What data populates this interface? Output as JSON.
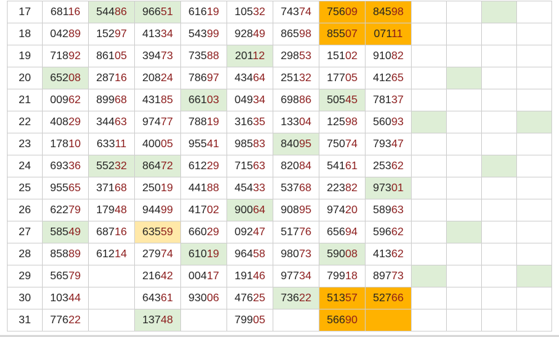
{
  "colors": {
    "green_cell": "#deeed6",
    "orange_cell": "#ffb200",
    "yellow_cell": "#ffe8a8",
    "row_number_text": "#2144c8",
    "last_two_digits_text": "#8b1a1a"
  },
  "rows": [
    {
      "day": "17",
      "cells": [
        {
          "v": "68116",
          "bg": ""
        },
        {
          "v": "54486",
          "bg": "g"
        },
        {
          "v": "96651",
          "bg": "g"
        },
        {
          "v": "61619",
          "bg": ""
        },
        {
          "v": "10532",
          "bg": ""
        },
        {
          "v": "74374",
          "bg": ""
        },
        {
          "v": "75609",
          "bg": "o"
        },
        {
          "v": "84598",
          "bg": "o"
        }
      ],
      "pads": [
        "",
        "",
        "g",
        ""
      ]
    },
    {
      "day": "18",
      "cells": [
        {
          "v": "04289",
          "bg": ""
        },
        {
          "v": "15297",
          "bg": ""
        },
        {
          "v": "41334",
          "bg": ""
        },
        {
          "v": "54399",
          "bg": ""
        },
        {
          "v": "92849",
          "bg": ""
        },
        {
          "v": "86598",
          "bg": ""
        },
        {
          "v": "85507",
          "bg": "o"
        },
        {
          "v": "07111",
          "bg": "o"
        }
      ],
      "pads": [
        "",
        "",
        "",
        ""
      ]
    },
    {
      "day": "19",
      "cells": [
        {
          "v": "71892",
          "bg": ""
        },
        {
          "v": "86105",
          "bg": ""
        },
        {
          "v": "39473",
          "bg": ""
        },
        {
          "v": "73588",
          "bg": ""
        },
        {
          "v": "20112",
          "bg": "g"
        },
        {
          "v": "29853",
          "bg": ""
        },
        {
          "v": "15102",
          "bg": ""
        },
        {
          "v": "91082",
          "bg": ""
        }
      ],
      "pads": [
        "",
        "",
        "",
        ""
      ]
    },
    {
      "day": "20",
      "cells": [
        {
          "v": "65208",
          "bg": "g"
        },
        {
          "v": "28716",
          "bg": ""
        },
        {
          "v": "20824",
          "bg": ""
        },
        {
          "v": "78697",
          "bg": ""
        },
        {
          "v": "43464",
          "bg": ""
        },
        {
          "v": "25132",
          "bg": ""
        },
        {
          "v": "17705",
          "bg": ""
        },
        {
          "v": "41265",
          "bg": ""
        }
      ],
      "pads": [
        "",
        "g",
        "",
        ""
      ]
    },
    {
      "day": "21",
      "cells": [
        {
          "v": "00962",
          "bg": ""
        },
        {
          "v": "89968",
          "bg": ""
        },
        {
          "v": "43185",
          "bg": ""
        },
        {
          "v": "66103",
          "bg": "g"
        },
        {
          "v": "04934",
          "bg": ""
        },
        {
          "v": "69886",
          "bg": ""
        },
        {
          "v": "50545",
          "bg": "g"
        },
        {
          "v": "78137",
          "bg": ""
        }
      ],
      "pads": [
        "",
        "",
        "",
        ""
      ]
    },
    {
      "day": "22",
      "cells": [
        {
          "v": "40829",
          "bg": ""
        },
        {
          "v": "34463",
          "bg": ""
        },
        {
          "v": "97477",
          "bg": ""
        },
        {
          "v": "78819",
          "bg": ""
        },
        {
          "v": "31635",
          "bg": ""
        },
        {
          "v": "13304",
          "bg": ""
        },
        {
          "v": "12598",
          "bg": ""
        },
        {
          "v": "56093",
          "bg": ""
        }
      ],
      "pads": [
        "g",
        "",
        "",
        "g"
      ]
    },
    {
      "day": "23",
      "cells": [
        {
          "v": "17810",
          "bg": ""
        },
        {
          "v": "63311",
          "bg": ""
        },
        {
          "v": "40005",
          "bg": ""
        },
        {
          "v": "95541",
          "bg": ""
        },
        {
          "v": "98583",
          "bg": ""
        },
        {
          "v": "84095",
          "bg": "g"
        },
        {
          "v": "75074",
          "bg": ""
        },
        {
          "v": "79347",
          "bg": ""
        }
      ],
      "pads": [
        "",
        "",
        "",
        ""
      ]
    },
    {
      "day": "24",
      "cells": [
        {
          "v": "69336",
          "bg": ""
        },
        {
          "v": "55232",
          "bg": "g"
        },
        {
          "v": "86472",
          "bg": "g"
        },
        {
          "v": "61229",
          "bg": ""
        },
        {
          "v": "71563",
          "bg": ""
        },
        {
          "v": "82084",
          "bg": ""
        },
        {
          "v": "54161",
          "bg": ""
        },
        {
          "v": "25362",
          "bg": ""
        }
      ],
      "pads": [
        "",
        "",
        "g",
        ""
      ]
    },
    {
      "day": "25",
      "cells": [
        {
          "v": "95565",
          "bg": ""
        },
        {
          "v": "37168",
          "bg": ""
        },
        {
          "v": "25019",
          "bg": ""
        },
        {
          "v": "44188",
          "bg": ""
        },
        {
          "v": "45433",
          "bg": ""
        },
        {
          "v": "53768",
          "bg": ""
        },
        {
          "v": "22382",
          "bg": ""
        },
        {
          "v": "97301",
          "bg": "g"
        }
      ],
      "pads": [
        "",
        "",
        "",
        ""
      ]
    },
    {
      "day": "26",
      "cells": [
        {
          "v": "62279",
          "bg": ""
        },
        {
          "v": "17948",
          "bg": ""
        },
        {
          "v": "94499",
          "bg": ""
        },
        {
          "v": "41702",
          "bg": ""
        },
        {
          "v": "90064",
          "bg": "g"
        },
        {
          "v": "90895",
          "bg": ""
        },
        {
          "v": "97420",
          "bg": ""
        },
        {
          "v": "58963",
          "bg": ""
        }
      ],
      "pads": [
        "",
        "",
        "",
        ""
      ]
    },
    {
      "day": "27",
      "cells": [
        {
          "v": "58549",
          "bg": "g"
        },
        {
          "v": "68716",
          "bg": ""
        },
        {
          "v": "63559",
          "bg": "y"
        },
        {
          "v": "66029",
          "bg": ""
        },
        {
          "v": "09247",
          "bg": ""
        },
        {
          "v": "51776",
          "bg": ""
        },
        {
          "v": "65694",
          "bg": ""
        },
        {
          "v": "59662",
          "bg": ""
        }
      ],
      "pads": [
        "",
        "g",
        "",
        ""
      ]
    },
    {
      "day": "28",
      "cells": [
        {
          "v": "85889",
          "bg": ""
        },
        {
          "v": "61214",
          "bg": ""
        },
        {
          "v": "27974",
          "bg": ""
        },
        {
          "v": "61019",
          "bg": "g"
        },
        {
          "v": "96458",
          "bg": ""
        },
        {
          "v": "98073",
          "bg": ""
        },
        {
          "v": "59008",
          "bg": "g"
        },
        {
          "v": "41362",
          "bg": ""
        }
      ],
      "pads": [
        "",
        "",
        "",
        ""
      ]
    },
    {
      "day": "29",
      "cells": [
        {
          "v": "56579",
          "bg": ""
        },
        {
          "v": "",
          "bg": ""
        },
        {
          "v": "21642",
          "bg": ""
        },
        {
          "v": "00417",
          "bg": ""
        },
        {
          "v": "19146",
          "bg": ""
        },
        {
          "v": "97734",
          "bg": ""
        },
        {
          "v": "79918",
          "bg": ""
        },
        {
          "v": "89773",
          "bg": ""
        }
      ],
      "pads": [
        "g",
        "",
        "",
        "g"
      ]
    },
    {
      "day": "30",
      "cells": [
        {
          "v": "10344",
          "bg": ""
        },
        {
          "v": "",
          "bg": ""
        },
        {
          "v": "64361",
          "bg": ""
        },
        {
          "v": "93006",
          "bg": ""
        },
        {
          "v": "47625",
          "bg": ""
        },
        {
          "v": "73622",
          "bg": "g"
        },
        {
          "v": "51357",
          "bg": "o"
        },
        {
          "v": "52766",
          "bg": "o"
        }
      ],
      "pads": [
        "",
        "",
        "",
        ""
      ]
    },
    {
      "day": "31",
      "cells": [
        {
          "v": "77622",
          "bg": ""
        },
        {
          "v": "",
          "bg": ""
        },
        {
          "v": "13748",
          "bg": "g"
        },
        {
          "v": "",
          "bg": ""
        },
        {
          "v": "79905",
          "bg": ""
        },
        {
          "v": "",
          "bg": ""
        },
        {
          "v": "56690",
          "bg": "o"
        },
        {
          "v": "",
          "bg": "o"
        }
      ],
      "pads": [
        "",
        "",
        "",
        ""
      ]
    }
  ]
}
